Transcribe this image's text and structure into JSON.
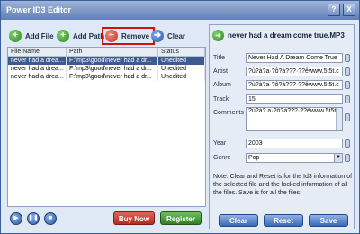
{
  "window": {
    "title": "Power ID3 Editor",
    "help": "?",
    "close": "X"
  },
  "toolbar": {
    "add_file": "Add File",
    "add_path": "Add Path",
    "remove": "Remove",
    "clear": "Clear"
  },
  "files": {
    "columns": [
      "File Name",
      "Path",
      "Status"
    ],
    "rows": [
      {
        "name": "never had a drea...",
        "path": "F:\\mp3\\good\\never had a dr...",
        "status": "Unedited",
        "selected": true
      },
      {
        "name": "never had a drea...",
        "path": "F:\\mp3\\good\\never had a dr...",
        "status": "Unedited",
        "selected": false
      },
      {
        "name": "never had a drea...",
        "path": "F:\\mp3\\good\\never had a dr...",
        "status": "Unedited",
        "selected": false
      }
    ]
  },
  "footer_left": {
    "buy_now": "Buy Now",
    "register": "Register"
  },
  "editor": {
    "file_title": "never had a dream come true.MP3",
    "fields": {
      "title_label": "Title",
      "title_value": "Never Had A Dream Come True",
      "artist_label": "Artist",
      "artist_value": "?ù?à?a·?ô?à???·??êwww.5t5t.c",
      "album_label": "Album",
      "album_value": "?ù?à?a·?ô?à???·??êwww.5t5t.c",
      "track_label": "Track",
      "track_value": "15",
      "comments_label": "Comments",
      "comments_value": "?ù?à? a·?ô?à???·??êwww.5t5t.c",
      "year_label": "Year",
      "year_value": "2003",
      "genre_label": "Genre",
      "genre_value": "Pop"
    },
    "note": "Note:  Clear and Reset is for the Id3 information of the selected file and the locked information of all the files.  Save is for all the files.",
    "buttons": {
      "clear": "Clear",
      "reset": "Reset",
      "save": "Save"
    }
  },
  "colors": {
    "accent": "#3d5b8e",
    "remove_highlight": "#d11010"
  }
}
